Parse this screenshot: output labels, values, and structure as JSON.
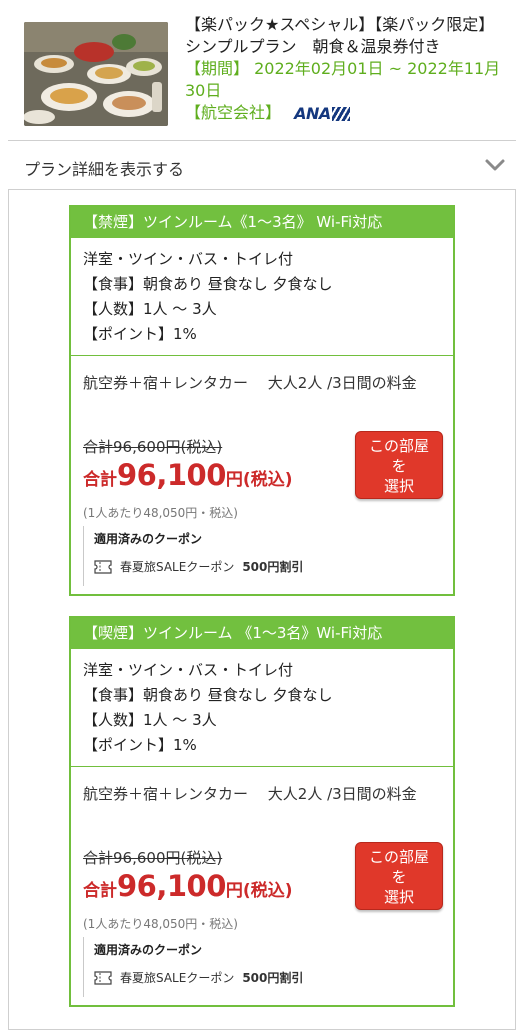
{
  "plan": {
    "title": "【楽パック★スペシャル】【楽パック限定】シンプルプラン　朝食＆温泉券付き",
    "period": "【期間】 2022年02月01日 ~ 2022年11月30日",
    "airline_label": "【航空会社】",
    "airline_name": "ANA"
  },
  "details_toggle": {
    "label": "プラン詳細を表示する",
    "icon": "chevron-down-icon"
  },
  "rooms": [
    {
      "header": "【禁煙】ツインルーム《1〜3名》 Wi-Fi対応",
      "info": [
        "洋室・ツイン・バス・トイレ付",
        "【食事】朝食あり 昼食なし 夕食なし",
        "【人数】1人 〜 3人",
        "【ポイント】1%"
      ],
      "package": "航空券＋宿＋レンタカー　 大人2人 /3日間の料金",
      "old_price": "合計96,600円(税込)",
      "price_prefix": "合計",
      "price_value": "96,100",
      "price_suffix": "円(税込)",
      "per_person": "(1人あたり48,050円・税込)",
      "coupon_title": "適用済みのクーポン",
      "coupon_name": "春夏旅SALEクーポン",
      "coupon_discount": "500円割引",
      "button_lines": [
        "この部屋",
        "を",
        "選択"
      ]
    },
    {
      "header": "【喫煙】ツインルーム 《1〜3名》Wi-Fi対応",
      "info": [
        "洋室・ツイン・バス・トイレ付",
        "【食事】朝食あり 昼食なし 夕食なし",
        "【人数】1人 〜 3人",
        "【ポイント】1%"
      ],
      "package": "航空券＋宿＋レンタカー　 大人2人 /3日間の料金",
      "old_price": "合計96,600円(税込)",
      "price_prefix": "合計",
      "price_value": "96,100",
      "price_suffix": "円(税込)",
      "per_person": "(1人あたり48,050円・税込)",
      "coupon_title": "適用済みのクーポン",
      "coupon_name": "春夏旅SALEクーポン",
      "coupon_discount": "500円割引",
      "button_lines": [
        "この部屋",
        "を",
        "選択"
      ]
    }
  ],
  "colors": {
    "green": "#72c03f",
    "red_price": "#cc2a2a",
    "button_red": "#e0382a",
    "ana_blue": "#15387f"
  }
}
